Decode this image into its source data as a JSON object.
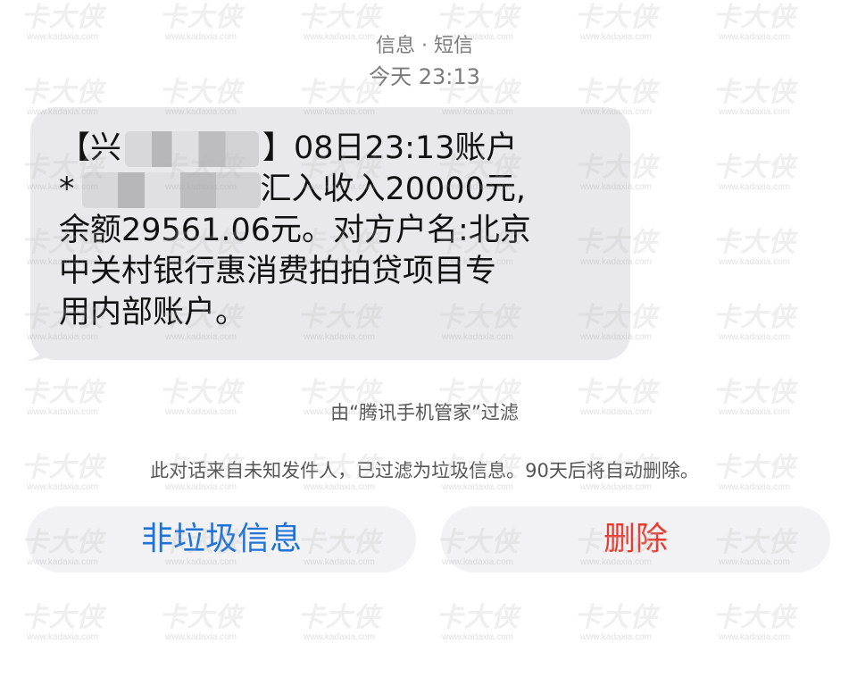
{
  "header": {
    "title": "信息 · 短信",
    "time": "今天 23:13"
  },
  "message": {
    "line1_prefix": "【兴",
    "line1_suffix": "】08日23:13账户",
    "line2_prefix": "*",
    "line2_suffix": "汇入收入20000元,",
    "line3": "余额29561.06元。对方户名:北京",
    "line4": "中关村银行惠消费拍拍贷项目专",
    "line5": "用内部账户。"
  },
  "filter_note": "由“腾讯手机管家”过滤",
  "junk_note": "此对话来自未知发件人，已过滤为垃圾信息。90天后将自动删除。",
  "buttons": {
    "not_junk": "非垃圾信息",
    "delete": "删除"
  },
  "colors": {
    "bubble": "#e9e9eb",
    "button_bg": "#f2f2f4",
    "link_blue": "#1e72d8",
    "delete_red": "#ea3a30",
    "secondary_text": "#7a7a7a"
  },
  "watermark": {
    "logo": "卡大侠",
    "url": "www.kadaxia.com"
  }
}
